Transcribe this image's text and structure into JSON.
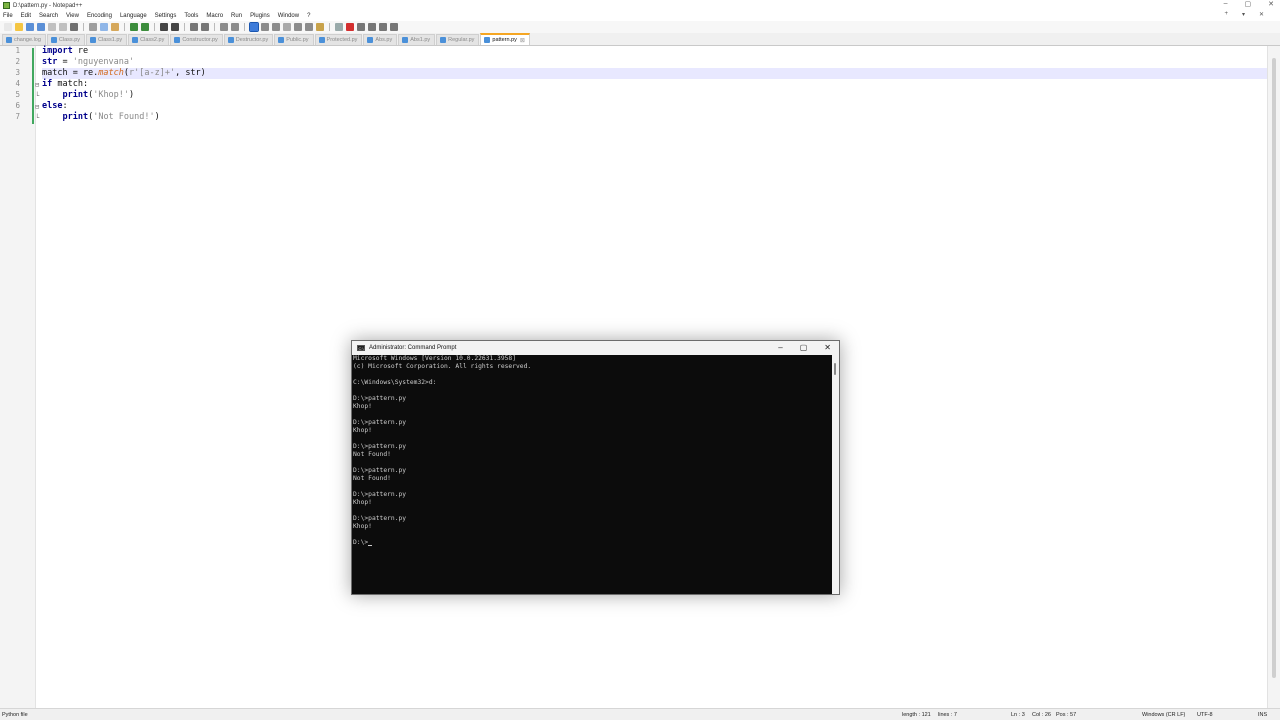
{
  "window": {
    "title": "D:\\pattern.py - Notepad++",
    "controls": [
      "–",
      "▢",
      "✕"
    ]
  },
  "menu": {
    "items": [
      "File",
      "Edit",
      "Search",
      "View",
      "Encoding",
      "Language",
      "Settings",
      "Tools",
      "Macro",
      "Run",
      "Plugins",
      "Window",
      "?"
    ],
    "right": [
      "+",
      "▾",
      "✕"
    ]
  },
  "tabs": [
    {
      "label": "change.log",
      "active": false
    },
    {
      "label": "Class.py",
      "active": false
    },
    {
      "label": "Class1.py",
      "active": false
    },
    {
      "label": "Class2.py",
      "active": false
    },
    {
      "label": "Constructor.py",
      "active": false
    },
    {
      "label": "Destructor.py",
      "active": false
    },
    {
      "label": "Public.py",
      "active": false
    },
    {
      "label": "Protected.py",
      "active": false
    },
    {
      "label": "Abs.py",
      "active": false
    },
    {
      "label": "Abs1.py",
      "active": false
    },
    {
      "label": "Regular.py",
      "active": false
    },
    {
      "label": "pattern.py",
      "active": true
    }
  ],
  "editor": {
    "line_numbers": [
      "1",
      "2",
      "3",
      "4",
      "5",
      "6",
      "7"
    ],
    "current_line": 3
  },
  "code": {
    "l1_kw": "import",
    "l1_rest": " re",
    "l2_kw": "str",
    "l2_op": " = ",
    "l2_str": "'nguyenvana'",
    "l3_a": "match = re.",
    "l3_fn": "match",
    "l3_b": "(",
    "l3_str": "r'[a-z]+'",
    "l3_c": ", str)",
    "l4_kw": "if",
    "l4_rest": " match:",
    "l5_indent": "    ",
    "l5_kw": "print",
    "l5_b": "(",
    "l5_str": "'Khop!'",
    "l5_c": ")",
    "l6_kw": "else",
    "l6_rest": ":",
    "l7_indent": "    ",
    "l7_kw": "print",
    "l7_b": "(",
    "l7_str": "'Not Found!'",
    "l7_c": ")"
  },
  "cmd": {
    "title": "Administrator: Command Prompt",
    "icon_text": "C:\\",
    "controls": [
      "–",
      "▢",
      "✕"
    ],
    "lines": [
      "Microsoft Windows [Version 10.0.22631.3958]",
      "(c) Microsoft Corporation. All rights reserved.",
      "",
      "C:\\Windows\\System32>d:",
      "",
      "D:\\>pattern.py",
      "Khop!",
      "",
      "D:\\>pattern.py",
      "Khop!",
      "",
      "D:\\>pattern.py",
      "Not Found!",
      "",
      "D:\\>pattern.py",
      "Not Found!",
      "",
      "D:\\>pattern.py",
      "Khop!",
      "",
      "D:\\>pattern.py",
      "Khop!",
      ""
    ],
    "prompt": "D:\\>"
  },
  "status": {
    "file_type": "Python file",
    "length": "length : 121",
    "lines": "lines : 7",
    "ln": "Ln : 3",
    "col": "Col : 26",
    "pos": "Pos : 57",
    "eol": "Windows (CR LF)",
    "encoding": "UTF-8",
    "mode": "INS"
  },
  "toolbar_icons": [
    "new-file-icon",
    "open-file-icon",
    "save-icon",
    "save-all-icon",
    "close-icon",
    "close-all-icon",
    "print-icon",
    "cut-icon",
    "copy-icon",
    "paste-icon",
    "undo-icon",
    "redo-icon",
    "find-icon",
    "replace-icon",
    "zoom-in-icon",
    "zoom-out-icon",
    "sync-v-icon",
    "sync-h-icon",
    "wrap-icon",
    "all-chars-icon",
    "indent-guide-icon",
    "udl-icon",
    "doc-map-icon",
    "function-list-icon",
    "folder-workspace-icon",
    "monitor-icon",
    "record-macro-icon",
    "stop-macro-icon",
    "play-macro-icon",
    "run-macro-icon",
    "save-macro-icon"
  ],
  "colors": {
    "active_tab_accent": "#f5a623",
    "keyword": "#00008b",
    "string": "#8a8a8a",
    "function": "#d2691e",
    "console_bg": "#0c0c0c",
    "console_fg": "#cccccc",
    "change_bar": "#41a85f"
  }
}
